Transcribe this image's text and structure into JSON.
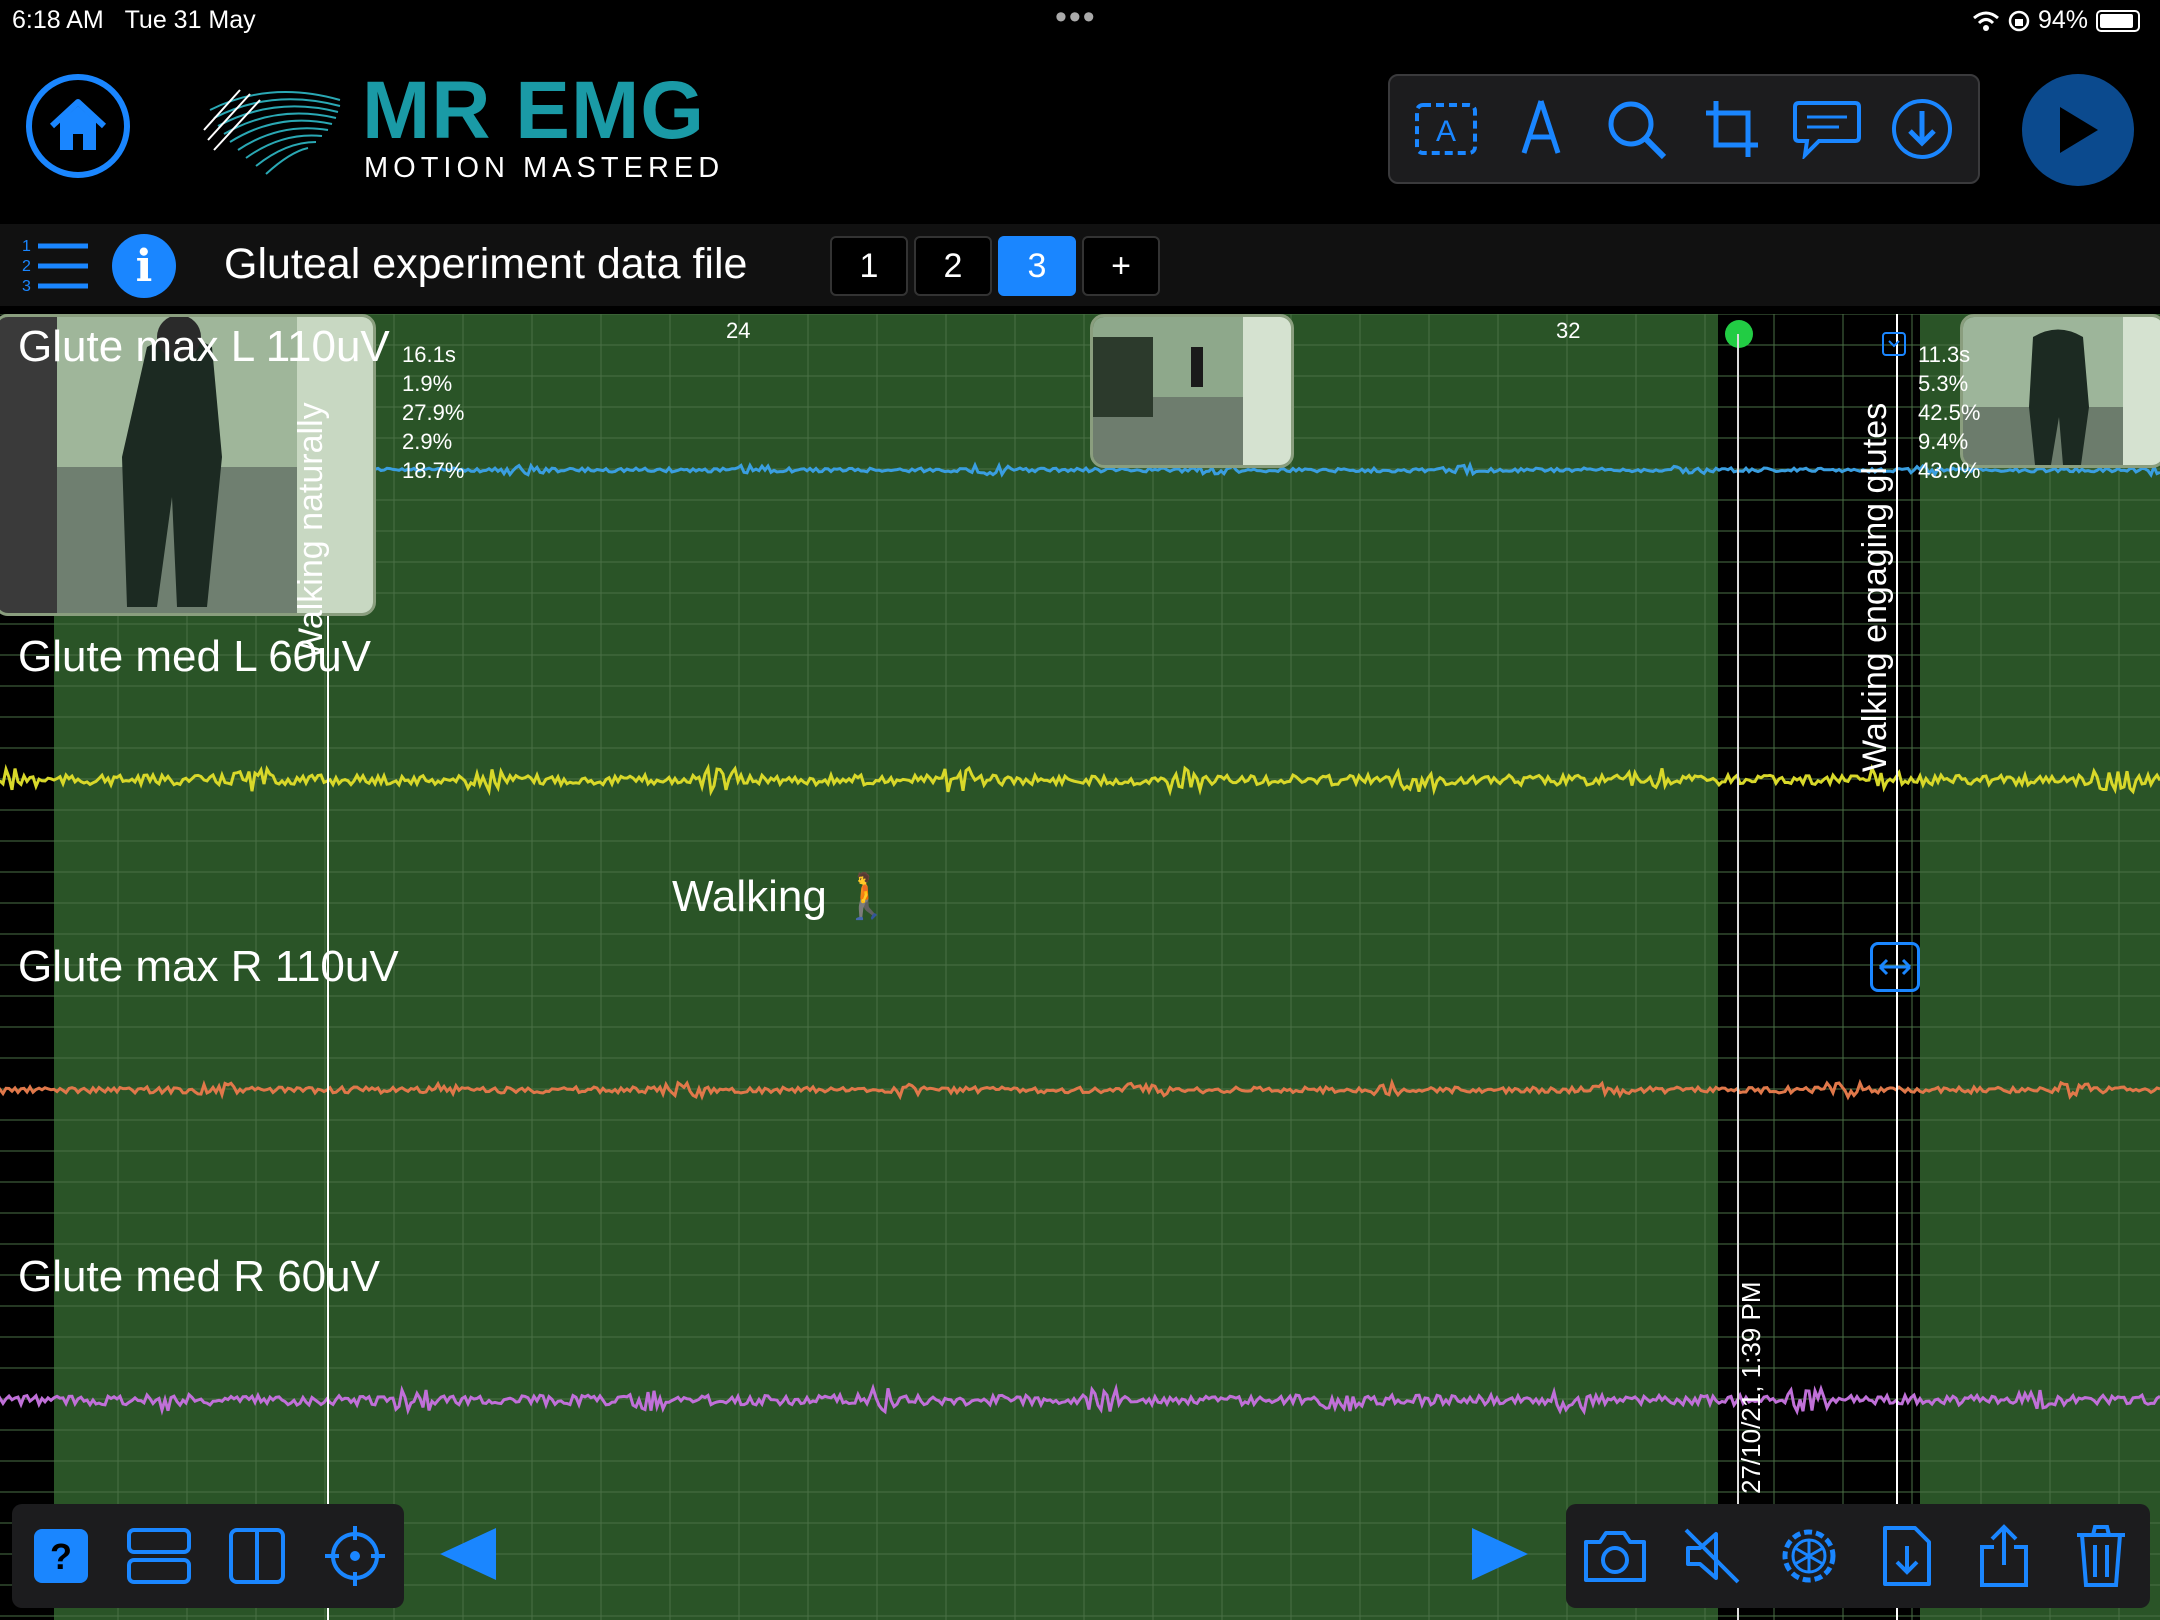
{
  "status_bar": {
    "time": "6:18 AM",
    "date": "Tue 31 May",
    "battery": "94%"
  },
  "header": {
    "brand_title": "MR EMG",
    "brand_subtitle": "MOTION MASTERED",
    "tools": [
      "text-box-icon",
      "pen-icon",
      "search-icon",
      "crop-icon",
      "comment-icon",
      "download-icon"
    ]
  },
  "file_bar": {
    "title": "Gluteal experiment data file",
    "tabs": [
      "1",
      "2",
      "3",
      "+"
    ],
    "active_tab": "3"
  },
  "plot": {
    "channels": [
      {
        "name": "Glute max L 110uV",
        "color": "#3a9ee0"
      },
      {
        "name": "Glute med L 60uV",
        "color": "#d8d82a"
      },
      {
        "name": "Glute max R 110uV",
        "color": "#e0784a"
      },
      {
        "name": "Glute med R 60uV",
        "color": "#c070d8"
      }
    ],
    "axis_ticks": [
      "24",
      "32"
    ],
    "stats_left": [
      "16.1s",
      "1.9%",
      "27.9%",
      "2.9%",
      "18.7%"
    ],
    "stats_right": [
      "11.3s",
      "5.3%",
      "42.5%",
      "9.4%",
      "43.0%"
    ],
    "annotation_walking_naturally": "Walking naturally",
    "annotation_walking_engaging": "Walking engaging glutes",
    "annotation_walking": "Walking 🚶",
    "timestamp": "27/10/21, 1:39 PM"
  },
  "colors": {
    "accent": "#1a86ff",
    "brand": "#1a9aa6",
    "plot_bg": "#2a5427"
  }
}
